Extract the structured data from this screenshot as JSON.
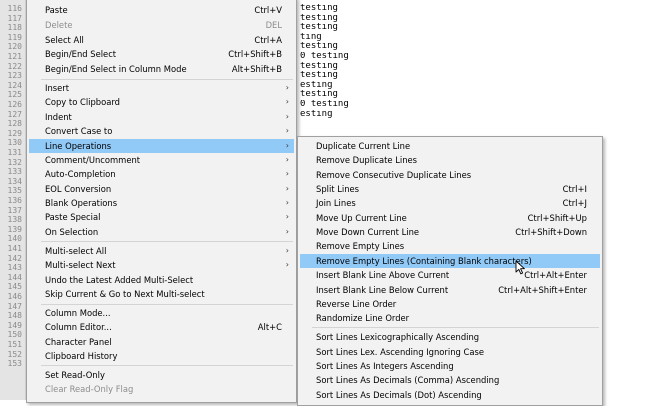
{
  "editor": {
    "line_numbers": [
      "116",
      "117",
      "118",
      "119",
      "120",
      "121",
      "122",
      "123",
      "124",
      "125",
      "126",
      "127",
      "128",
      "129",
      "130",
      "131",
      "132",
      "133",
      "134",
      "135",
      "136",
      "137",
      "138",
      "139",
      "140",
      "141",
      "142",
      "143",
      "144",
      "145",
      "146",
      "147",
      "148",
      "149",
      "150",
      "151",
      "152",
      "153"
    ],
    "code_lines": [
      "testing",
      "testing",
      "testing",
      "ting",
      "testing",
      "0 testing",
      "testing",
      "testing",
      "esting",
      "testing",
      "0 testing",
      "esting"
    ]
  },
  "main_menu": {
    "items": [
      {
        "label": "Paste",
        "shortcut": "Ctrl+V"
      },
      {
        "label": "Delete",
        "shortcut": "DEL"
      },
      {
        "label": "Select All",
        "shortcut": "Ctrl+A"
      },
      {
        "label": "Begin/End Select",
        "shortcut": "Ctrl+Shift+B"
      },
      {
        "label": "Begin/End Select in Column Mode",
        "shortcut": "Alt+Shift+B"
      },
      {
        "label": "Insert"
      },
      {
        "label": "Copy to Clipboard"
      },
      {
        "label": "Indent"
      },
      {
        "label": "Convert Case to"
      },
      {
        "label": "Line Operations"
      },
      {
        "label": "Comment/Uncomment"
      },
      {
        "label": "Auto-Completion"
      },
      {
        "label": "EOL Conversion"
      },
      {
        "label": "Blank Operations"
      },
      {
        "label": "Paste Special"
      },
      {
        "label": "On Selection"
      },
      {
        "label": "Multi-select All"
      },
      {
        "label": "Multi-select Next"
      },
      {
        "label": "Undo the Latest Added Multi-Select"
      },
      {
        "label": "Skip Current & Go to Next Multi-select"
      },
      {
        "label": "Column Mode..."
      },
      {
        "label": "Column Editor...",
        "shortcut": "Alt+C"
      },
      {
        "label": "Character Panel"
      },
      {
        "label": "Clipboard History"
      },
      {
        "label": "Set Read-Only"
      },
      {
        "label": "Clear Read-Only Flag"
      }
    ],
    "arrow_glyph": "›"
  },
  "sub_menu": {
    "items": [
      {
        "label": "Duplicate Current Line"
      },
      {
        "label": "Remove Duplicate Lines"
      },
      {
        "label": "Remove Consecutive Duplicate Lines"
      },
      {
        "label": "Split Lines",
        "shortcut": "Ctrl+I"
      },
      {
        "label": "Join Lines",
        "shortcut": "Ctrl+J"
      },
      {
        "label": "Move Up Current Line",
        "shortcut": "Ctrl+Shift+Up"
      },
      {
        "label": "Move Down Current Line",
        "shortcut": "Ctrl+Shift+Down"
      },
      {
        "label": "Remove Empty Lines"
      },
      {
        "label": "Remove Empty Lines (Containing Blank characters)"
      },
      {
        "label": "Insert Blank Line Above Current",
        "shortcut": "Ctrl+Alt+Enter"
      },
      {
        "label": "Insert Blank Line Below Current",
        "shortcut": "Ctrl+Alt+Shift+Enter"
      },
      {
        "label": "Reverse Line Order"
      },
      {
        "label": "Randomize Line Order"
      },
      {
        "label": "Sort Lines Lexicographically Ascending"
      },
      {
        "label": "Sort Lines Lex. Ascending Ignoring Case"
      },
      {
        "label": "Sort Lines As Integers Ascending"
      },
      {
        "label": "Sort Lines As Decimals (Comma) Ascending"
      },
      {
        "label": "Sort Lines As Decimals (Dot) Ascending"
      }
    ]
  },
  "colors": {
    "highlight": "#91c9f7",
    "menu_bg": "#f2f2f2",
    "disabled_text": "#8d8d8d"
  },
  "cursor_icon": "mouse-pointer-icon"
}
